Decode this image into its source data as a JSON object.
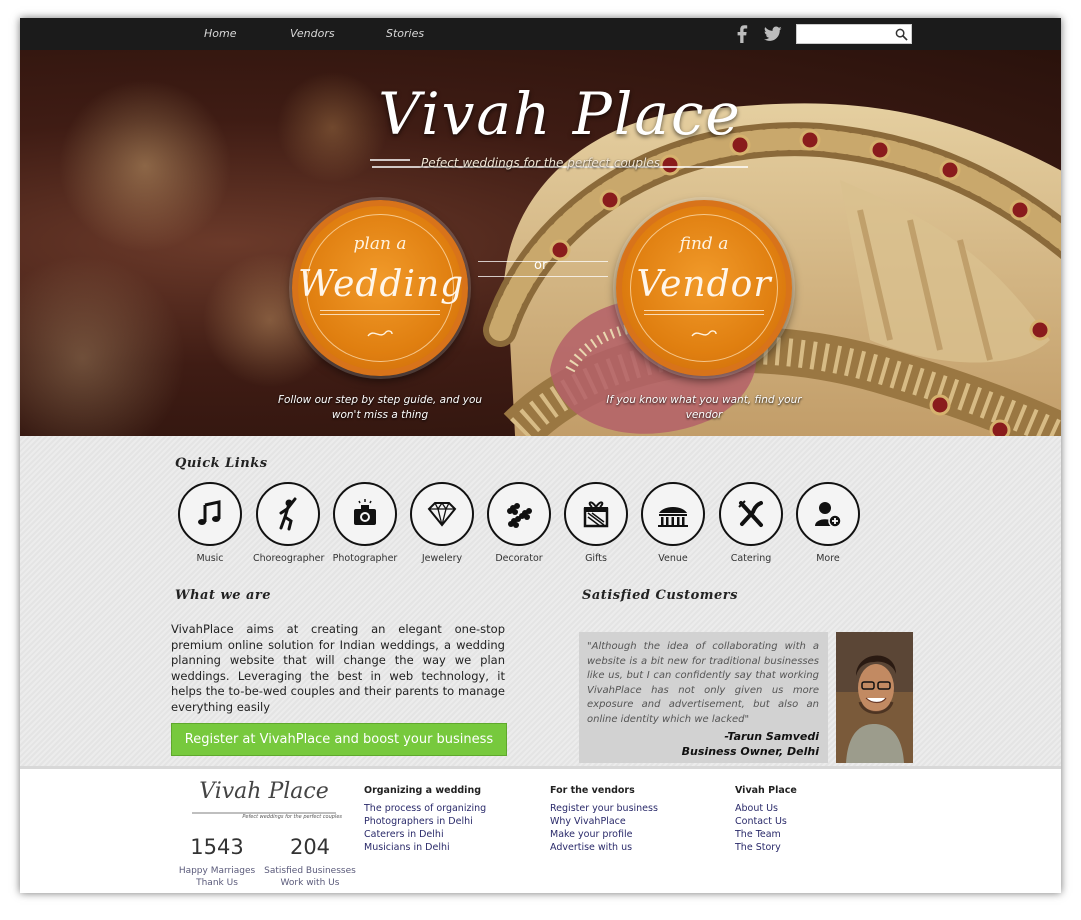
{
  "nav": {
    "items": [
      "Home",
      "Vendors",
      "Stories"
    ],
    "social": [
      "facebook-icon",
      "twitter-icon"
    ],
    "search_value": ""
  },
  "hero": {
    "logo_text": "Vivah Place",
    "tagline": "Pefect weddings for the perfect couples",
    "plan_button": {
      "small": "plan a",
      "big": "Wedding"
    },
    "vendor_button": {
      "small": "find a",
      "big": "Vendor"
    },
    "or_text": "or",
    "plan_caption": "Follow our step by step guide, and you won't miss a thing",
    "vendor_caption": "If you know what you want, find your vendor"
  },
  "quick_links": {
    "heading": "Quick Links",
    "items": [
      {
        "label": "Music",
        "icon": "music-note-icon"
      },
      {
        "label": "Choreographer",
        "icon": "dancer-icon"
      },
      {
        "label": "Photographer",
        "icon": "camera-icon"
      },
      {
        "label": "Jewelery",
        "icon": "diamond-icon"
      },
      {
        "label": "Decorator",
        "icon": "flowers-icon"
      },
      {
        "label": "Gifts",
        "icon": "gift-icon"
      },
      {
        "label": "Venue",
        "icon": "venue-icon"
      },
      {
        "label": "Catering",
        "icon": "cutlery-icon"
      },
      {
        "label": "More",
        "icon": "add-user-icon"
      }
    ]
  },
  "about": {
    "heading": "What we are",
    "text": "VivahPlace aims at creating an elegant one-stop premium online solution for Indian weddings, a wedding planning website that will change the way we plan weddings. Leveraging the best in web technology, it helps the to-be-wed couples and their parents to manage everything easily",
    "register_label": "Register at VivahPlace and boost your business"
  },
  "testimonials": {
    "heading": "Satisfied Customers",
    "quote": "\"Although the idea of collaborating with a website is a bit new for traditional businesses like us, but I can confidently say that working VivahPlace has not only given us more exposure and advertisement, but also an online identity which we lacked\"",
    "author_name": "-Tarun Samvedi",
    "author_role": "Business Owner, Delhi"
  },
  "footer": {
    "logo_text": "Vivah Place",
    "logo_tagline": "Pefect weddings for the perfect couples",
    "stats": [
      {
        "value": "1543",
        "label1": "Happy Marriages",
        "label2": "Thank Us"
      },
      {
        "value": "204",
        "label1": "Satisfied Businesses",
        "label2": "Work with Us"
      }
    ],
    "columns": [
      {
        "title": "Organizing a wedding",
        "links": [
          "The process of organizing",
          "Photographers in Delhi",
          "Caterers in Delhi",
          "Musicians in Delhi"
        ]
      },
      {
        "title": "For the vendors",
        "links": [
          "Register your business",
          "Why VivahPlace",
          "Make your profile",
          "Advertise with us"
        ]
      },
      {
        "title": "Vivah Place",
        "links": [
          "About Us",
          "Contact Us",
          "The Team",
          "The Story"
        ]
      }
    ]
  },
  "colors": {
    "accent_orange": "#e07f10",
    "register_green": "#77c93d",
    "nav_bg": "#1b1b1b"
  }
}
